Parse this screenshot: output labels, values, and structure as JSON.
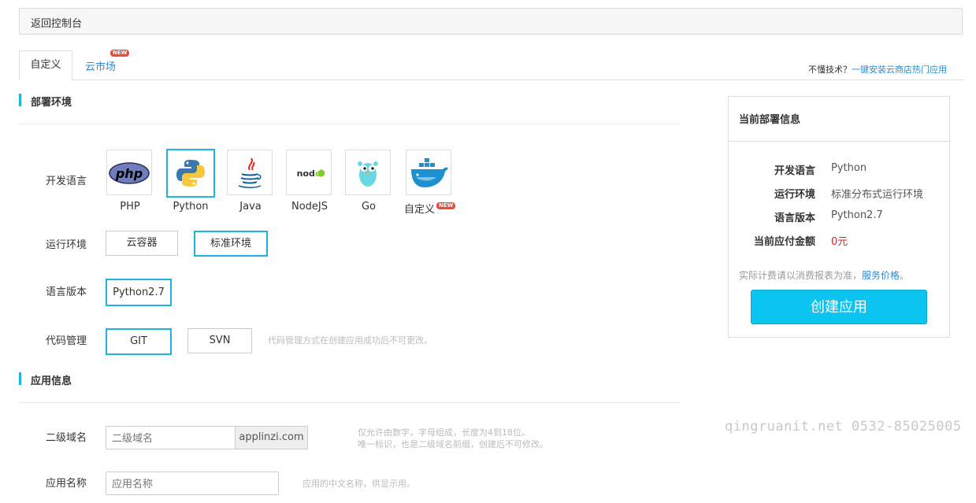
{
  "topbar": {
    "back_label": "返回控制台"
  },
  "tabs": [
    {
      "label": "自定义",
      "active": true
    },
    {
      "label": "云市场",
      "badge": "NEW"
    }
  ],
  "hint": {
    "text": "不懂技术？",
    "link": "一键安装云商店热门应用"
  },
  "deploy": {
    "title": "部署环境",
    "dev_lang_label": "开发语言",
    "languages": [
      {
        "name": "PHP",
        "icon": "php-icon"
      },
      {
        "name": "Python",
        "icon": "python-icon",
        "selected": true
      },
      {
        "name": "Java",
        "icon": "java-icon"
      },
      {
        "name": "NodeJS",
        "icon": "nodejs-icon"
      },
      {
        "name": "Go",
        "icon": "go-gopher-icon"
      },
      {
        "name": "自定义",
        "icon": "docker-icon",
        "badge": "NEW"
      }
    ],
    "runtime_label": "运行环境",
    "runtimes": [
      {
        "label": "云容器"
      },
      {
        "label": "标准环境",
        "selected": true
      }
    ],
    "version_label": "语言版本",
    "versions": [
      {
        "label": "Python2.7",
        "selected": true
      }
    ],
    "code_label": "代码管理",
    "code_options": [
      {
        "label": "GIT",
        "selected": true
      },
      {
        "label": "SVN"
      }
    ],
    "code_hint": "代码管理方式在创建应用成功后不可更改。"
  },
  "app": {
    "title": "应用信息",
    "subdomain_label": "二级域名",
    "subdomain_placeholder": "二级域名",
    "subdomain_suffix": "applinzi.com",
    "subdomain_hint1": "仅允许由数字，字母组成，长度为4到18位。",
    "subdomain_hint2": "唯一标识，也是二级域名前缀，创建后不可修改。",
    "name_label": "应用名称",
    "name_placeholder": "应用名称",
    "name_hint": "应用的中文名称，供显示用。"
  },
  "summary": {
    "title": "当前部署信息",
    "rows": [
      {
        "k": "开发语言",
        "v": "Python"
      },
      {
        "k": "运行环境",
        "v": "标准分布式运行环境"
      },
      {
        "k": "语言版本",
        "v": "Python2.7"
      },
      {
        "k": "当前应付金额",
        "v": "0元"
      }
    ],
    "note": "实际计费请以消费报表为准，",
    "note_link": "服务价格",
    "note_end": "。",
    "create_label": "创建应用"
  },
  "colors": {
    "accent": "#1cb5e0",
    "link": "#2a8bd1",
    "price": "#e02020",
    "button": "#0cc4f0"
  },
  "watermark": "qingruanit.net 0532-85025005"
}
